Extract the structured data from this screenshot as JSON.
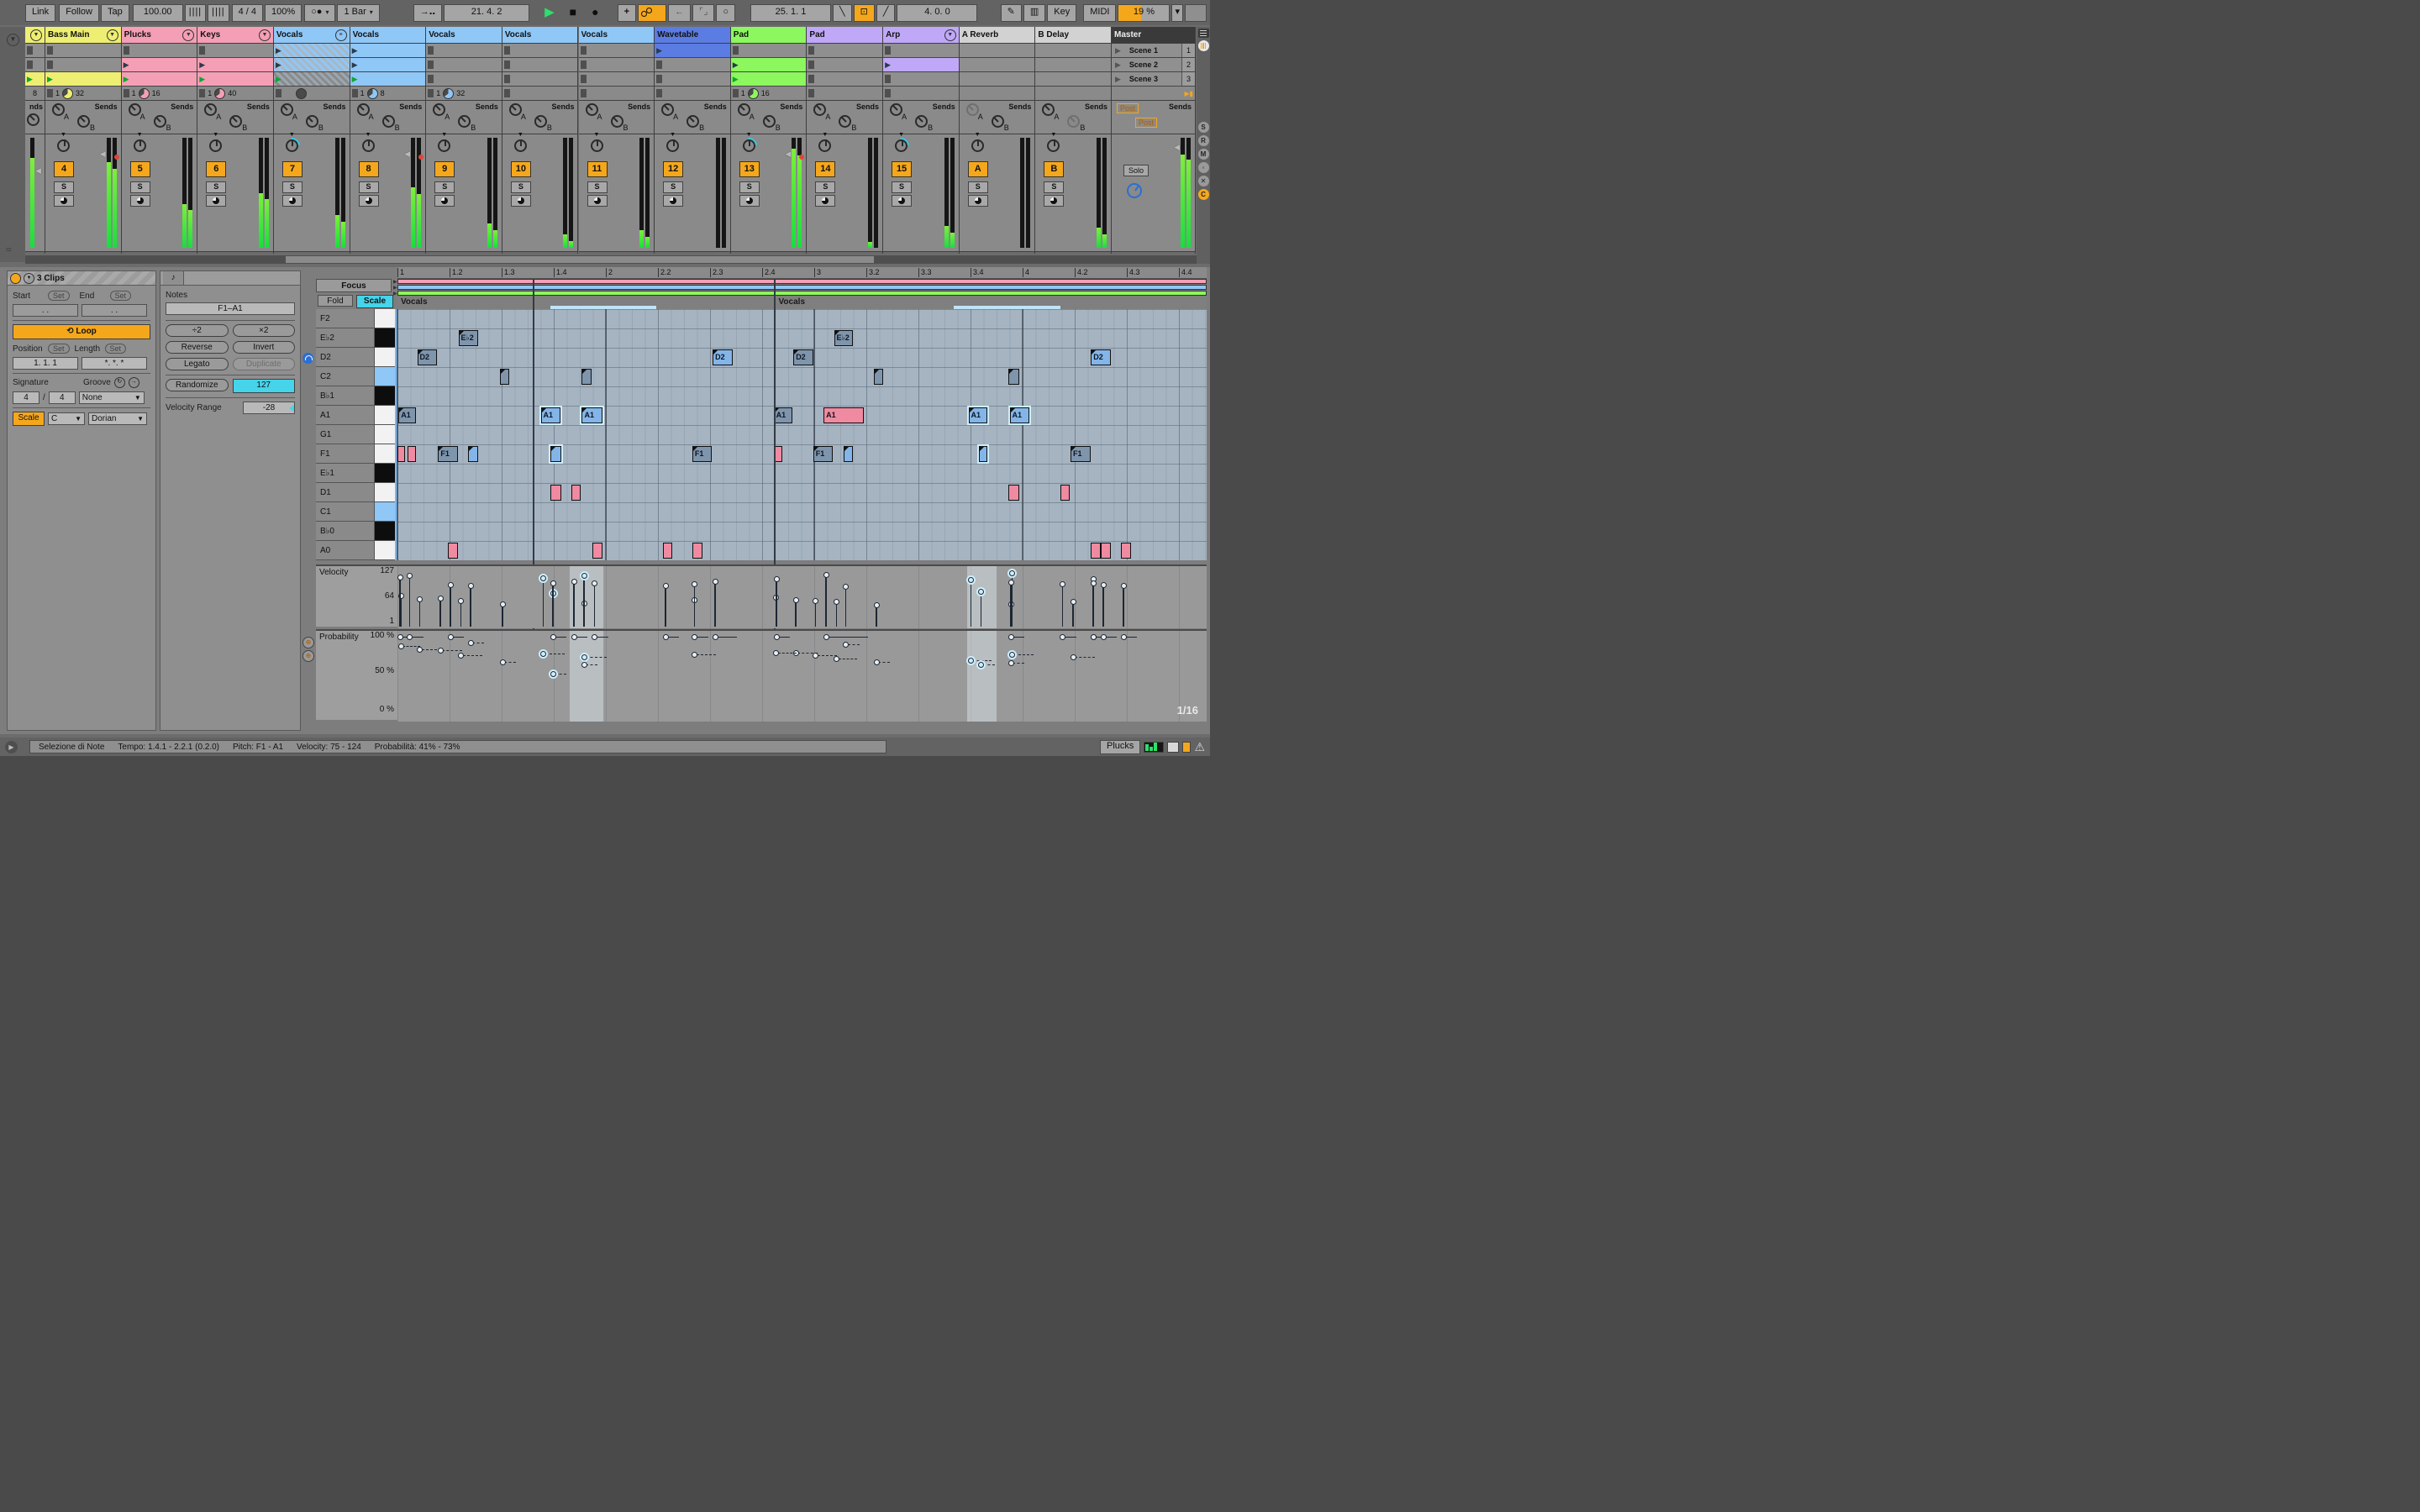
{
  "toolbar": {
    "link": "Link",
    "follow": "Follow",
    "tap": "Tap",
    "tempo": "100.00",
    "met_a": "||||",
    "met_b": "||||",
    "signature": "4 / 4",
    "global_quant": "100%",
    "metronome": "○●",
    "quantize_menu": "1 Bar",
    "follow_arrow": "→‥",
    "arrange_position": "21.  4.  2",
    "play": "▶",
    "stop": "■",
    "record": "●",
    "new": "+",
    "automation_arm": "oo",
    "reenable_automation": "←",
    "punch": "⌜⌟",
    "loop": "○",
    "loop_start": "25.  1.  1",
    "fade_in": "╲",
    "overdub": "⊡",
    "fade_out": "╱",
    "loop_length": "4.  0.  0",
    "draw": "✎",
    "fold_keys": "▥",
    "key": "Key",
    "midi": "MIDI",
    "cpu": "19 %",
    "caret": "▾"
  },
  "session": {
    "scenes": [
      {
        "name": "Scene 1",
        "num": "1"
      },
      {
        "name": "Scene 2",
        "num": "2"
      },
      {
        "name": "Scene 3",
        "num": "3"
      }
    ],
    "master_label": "Master",
    "rail_right_icons": [
      "S",
      "R",
      "M",
      "◦",
      "✕",
      "C"
    ],
    "tracks": [
      {
        "name": "",
        "color": "#eeee72",
        "narrow": true,
        "icon": "▼",
        "num": "",
        "slots": [
          "stop",
          "stop",
          "playing"
        ],
        "status": {
          "text": "8"
        },
        "meter": 0.82,
        "dot": false,
        "marker": true
      },
      {
        "name": "Bass Main",
        "color": "#eeee72",
        "icon": "▼",
        "num": "4",
        "slots": [
          "stop",
          "stop",
          "playing"
        ],
        "status": {
          "count": "1",
          "pie": "#eeee72",
          "total": "32"
        },
        "meter": 0.78,
        "dot": true,
        "marker": true
      },
      {
        "name": "Plucks",
        "color": "#f49fb6",
        "icon": "▼",
        "num": "5",
        "slots": [
          "stop",
          "clip",
          "playing"
        ],
        "status": {
          "count": "1",
          "pie": "#f49fb6",
          "total": "16"
        },
        "meter": 0.4,
        "dot": false,
        "marker": false
      },
      {
        "name": "Keys",
        "color": "#f49fb6",
        "icon": "▼",
        "num": "6",
        "slots": [
          "stop",
          "clip",
          "playing"
        ],
        "status": {
          "count": "1",
          "pie": "#f49fb6",
          "total": "40"
        },
        "meter": 0.5,
        "dot": false,
        "marker": false
      },
      {
        "name": "Vocals",
        "color": "#8fc7f7",
        "icon": "≡",
        "num": "7",
        "group": true,
        "slots": [
          "group",
          "group",
          "group-playing"
        ],
        "status": {
          "pie": "#555"
        },
        "meter": 0.3,
        "dot": false,
        "marker": false,
        "panarc": true
      },
      {
        "name": "Vocals",
        "color": "#8fc7f7",
        "icon": "",
        "num": "8",
        "slots": [
          "clip",
          "clip",
          "playing"
        ],
        "status": {
          "count": "1",
          "pie": "#8fc7f7",
          "total": "8"
        },
        "meter": 0.55,
        "dot": true,
        "marker": true
      },
      {
        "name": "Vocals",
        "color": "#8fc7f7",
        "icon": "",
        "num": "9",
        "slots": [
          "stop",
          "stop",
          "stop"
        ],
        "status": {
          "count": "1",
          "pie": "#8fc7f7",
          "total": "32"
        },
        "meter": 0.22,
        "dot": false,
        "marker": false
      },
      {
        "name": "Vocals",
        "color": "#8fc7f7",
        "icon": "",
        "num": "10",
        "slots": [
          "stop",
          "stop",
          "stop"
        ],
        "status": {
          "stop": true
        },
        "meter": 0.12,
        "dot": false,
        "marker": false
      },
      {
        "name": "Vocals",
        "color": "#8fc7f7",
        "icon": "",
        "num": "11",
        "slots": [
          "stop",
          "stop",
          "stop"
        ],
        "status": {
          "stop": true
        },
        "meter": 0.16,
        "dot": false,
        "marker": false
      },
      {
        "name": "Wavetable",
        "color": "#5b7ce2",
        "icon": "",
        "num": "12",
        "slots": [
          "clip",
          "stop",
          "stop"
        ],
        "status": {
          "stop": true
        },
        "meter": 0.0,
        "dot": false,
        "marker": false
      },
      {
        "name": "Pad",
        "color": "#8cf75e",
        "icon": "",
        "num": "13",
        "slots": [
          "stop",
          "clip",
          "playing"
        ],
        "status": {
          "count": "1",
          "pie": "#8cf75e",
          "total": "16"
        },
        "meter": 0.9,
        "dot": true,
        "marker": true,
        "panarc": true
      },
      {
        "name": "Pad",
        "color": "#c0a8f8",
        "icon": "",
        "num": "14",
        "slots": [
          "stop",
          "stop",
          "stop"
        ],
        "status": {
          "stop": true
        },
        "meter": 0.05,
        "dot": false,
        "marker": false
      },
      {
        "name": "Arp",
        "color": "#c0a8f8",
        "icon": "▼",
        "num": "15",
        "slots": [
          "stop",
          "clip",
          "stop"
        ],
        "status": {
          "stop": true
        },
        "meter": 0.2,
        "dot": false,
        "marker": false,
        "panarc": true
      },
      {
        "name": "A Reverb",
        "color": "#d2d2d2",
        "icon": "",
        "num": "A",
        "return": true,
        "slots": [
          "empty",
          "empty",
          "empty"
        ],
        "status": {},
        "meter": 0.0,
        "dot": false,
        "marker": false,
        "grayA": true
      },
      {
        "name": "B Delay",
        "color": "#d2d2d2",
        "icon": "",
        "num": "B",
        "return": true,
        "slots": [
          "empty",
          "empty",
          "empty"
        ],
        "status": {},
        "meter": 0.18,
        "dot": false,
        "marker": false,
        "grayB": true
      }
    ],
    "sends_label": "Sends",
    "master": {
      "post_a": "Post",
      "post_b": "Post",
      "solo": "Solo",
      "meter": 0.85
    }
  },
  "clip_panel": {
    "title": "3 Clips",
    "start": "Start",
    "end": "End",
    "set": "Set",
    "start_val": ".      .",
    "end_val": ".      .",
    "loop": "Loop",
    "position": "Position",
    "length": "Length",
    "position_val": "1.   1.   1",
    "length_val": "*.   *.   *",
    "signature": "Signature",
    "sig_n": "4",
    "sig_d": "4",
    "groove": "Groove",
    "groove_val": "None",
    "scale": "Scale",
    "root": "C",
    "scale_name": "Dorian"
  },
  "notes_panel": {
    "tab_icon": "♪",
    "notes_label": "Notes",
    "range": "F1–A1",
    "div2": "÷2",
    "mul2": "×2",
    "reverse": "Reverse",
    "invert": "Invert",
    "legato": "Legato",
    "duplicate": "Duplicate",
    "randomize": "Randomize",
    "randomize_val": "127",
    "velocity_range": "Velocity Range",
    "velocity_range_val": "-28"
  },
  "piano_roll": {
    "focus": "Focus",
    "fold": "Fold",
    "scale": "Scale",
    "ruler": [
      "1",
      "1.2",
      "1.3",
      "1.4",
      "2",
      "2.2",
      "2.3",
      "2.4",
      "3",
      "3.2",
      "3.3",
      "3.4",
      "4",
      "4.2",
      "4.3",
      "4.4"
    ],
    "region_labels": [
      "Vocals",
      "Vocals"
    ],
    "region_starts": [
      0,
      7.25
    ],
    "clip_lane_colors": [
      "#f49fb6",
      "#8fc7f7",
      "#8cf75e"
    ],
    "loop_braces": [
      [
        2.94,
        4.97
      ],
      [
        10.67,
        12.73
      ]
    ],
    "boundaries": [
      2.6,
      7.23
    ],
    "keys": [
      {
        "name": "F2",
        "type": "white"
      },
      {
        "name": "E♭2",
        "type": "black"
      },
      {
        "name": "D2",
        "type": "white"
      },
      {
        "name": "C2",
        "type": "root"
      },
      {
        "name": "B♭1",
        "type": "black"
      },
      {
        "name": "A1",
        "type": "white"
      },
      {
        "name": "G1",
        "type": "white"
      },
      {
        "name": "F1",
        "type": "white"
      },
      {
        "name": "E♭1",
        "type": "black"
      },
      {
        "name": "D1",
        "type": "white"
      },
      {
        "name": "C1",
        "type": "root"
      },
      {
        "name": "B♭0",
        "type": "black"
      },
      {
        "name": "A0",
        "type": "white"
      }
    ],
    "grid_division": "1/16",
    "notes": [
      {
        "row": 1,
        "start": 1.17,
        "len": 0.38,
        "label": "E♭2",
        "style": "gray",
        "v": 58,
        "p": 70
      },
      {
        "row": 1,
        "start": 8.38,
        "len": 0.37,
        "label": "E♭2",
        "style": "gray",
        "v": 55,
        "p": 65
      },
      {
        "row": 2,
        "start": 0.38,
        "len": 0.38,
        "label": "D2",
        "style": "gray",
        "v": 62,
        "p": 80
      },
      {
        "row": 2,
        "start": 6.05,
        "len": 0.38,
        "label": "D2",
        "style": "bright",
        "v": 105,
        "p": 100
      },
      {
        "row": 2,
        "start": 7.6,
        "len": 0.38,
        "label": "D2",
        "style": "gray",
        "v": 60,
        "p": 75
      },
      {
        "row": 2,
        "start": 13.31,
        "len": 0.39,
        "label": "D2",
        "style": "bright",
        "v": 110,
        "p": 100
      },
      {
        "row": 3,
        "start": 1.97,
        "len": 0.17,
        "label": "",
        "style": "gray",
        "v": 50,
        "p": 60
      },
      {
        "row": 3,
        "start": 3.54,
        "len": 0.18,
        "label": "",
        "style": "gray",
        "v": 52,
        "p": 55
      },
      {
        "row": 3,
        "start": 9.15,
        "len": 0.18,
        "label": "",
        "style": "gray",
        "v": 48,
        "p": 60
      },
      {
        "row": 3,
        "start": 11.73,
        "len": 0.2,
        "label": "",
        "style": "gray",
        "v": 50,
        "p": 58
      },
      {
        "row": 5,
        "start": 0.02,
        "len": 0.34,
        "label": "A1",
        "style": "gray",
        "v": 70,
        "p": 85
      },
      {
        "row": 5,
        "start": 2.75,
        "len": 0.38,
        "label": "A1",
        "style": "bright",
        "sel": true,
        "v": 112,
        "p": 73
      },
      {
        "row": 5,
        "start": 3.54,
        "len": 0.39,
        "label": "A1",
        "style": "bright",
        "sel": true,
        "v": 118,
        "p": 68
      },
      {
        "row": 5,
        "start": 7.22,
        "len": 0.36,
        "label": "A1",
        "style": "gray",
        "v": 66,
        "p": 75
      },
      {
        "row": 5,
        "start": 8.18,
        "len": 0.77,
        "label": "A1",
        "style": "pink",
        "v": 120,
        "p": 100
      },
      {
        "row": 5,
        "start": 10.96,
        "len": 0.37,
        "label": "A1",
        "style": "bright",
        "sel": true,
        "v": 108,
        "p": 62
      },
      {
        "row": 5,
        "start": 11.75,
        "len": 0.38,
        "label": "A1",
        "style": "bright",
        "sel": true,
        "v": 124,
        "p": 71
      },
      {
        "row": 7,
        "start": 0.0,
        "len": 0.15,
        "label": "",
        "style": "pink",
        "v": 115,
        "p": 100
      },
      {
        "row": 7,
        "start": 0.19,
        "len": 0.16,
        "label": "",
        "style": "pink",
        "v": 118,
        "p": 100
      },
      {
        "row": 7,
        "start": 0.78,
        "len": 0.38,
        "label": "F1",
        "style": "gray",
        "v": 64,
        "p": 78
      },
      {
        "row": 7,
        "start": 1.36,
        "len": 0.19,
        "label": "",
        "style": "bright",
        "v": 95,
        "p": 90
      },
      {
        "row": 7,
        "start": 2.94,
        "len": 0.2,
        "label": "",
        "style": "bright",
        "sel": true,
        "v": 75,
        "p": 41
      },
      {
        "row": 7,
        "start": 5.66,
        "len": 0.38,
        "label": "F1",
        "style": "gray",
        "v": 60,
        "p": 72
      },
      {
        "row": 7,
        "start": 7.23,
        "len": 0.15,
        "label": "",
        "style": "pink",
        "v": 110,
        "p": 100
      },
      {
        "row": 7,
        "start": 7.98,
        "len": 0.38,
        "label": "F1",
        "style": "gray",
        "v": 58,
        "p": 70
      },
      {
        "row": 7,
        "start": 8.56,
        "len": 0.19,
        "label": "",
        "style": "bright",
        "v": 92,
        "p": 88
      },
      {
        "row": 7,
        "start": 11.16,
        "len": 0.17,
        "label": "",
        "style": "bright",
        "sel": true,
        "v": 80,
        "p": 55
      },
      {
        "row": 7,
        "start": 12.92,
        "len": 0.39,
        "label": "F1",
        "style": "gray",
        "v": 56,
        "p": 68
      },
      {
        "row": 9,
        "start": 2.94,
        "len": 0.2,
        "label": "",
        "style": "pink",
        "v": 100,
        "p": 100
      },
      {
        "row": 9,
        "start": 3.34,
        "len": 0.18,
        "label": "",
        "style": "pink",
        "v": 105,
        "p": 100
      },
      {
        "row": 9,
        "start": 11.73,
        "len": 0.2,
        "label": "",
        "style": "pink",
        "v": 102,
        "p": 100
      },
      {
        "row": 9,
        "start": 12.72,
        "len": 0.18,
        "label": "",
        "style": "pink",
        "v": 98,
        "p": 100
      },
      {
        "row": 12,
        "start": 0.97,
        "len": 0.19,
        "label": "",
        "style": "pink",
        "v": 96,
        "p": 100
      },
      {
        "row": 12,
        "start": 3.74,
        "len": 0.19,
        "label": "",
        "style": "pink",
        "v": 100,
        "p": 100
      },
      {
        "row": 12,
        "start": 5.1,
        "len": 0.17,
        "label": "",
        "style": "pink",
        "v": 94,
        "p": 100
      },
      {
        "row": 12,
        "start": 5.66,
        "len": 0.19,
        "label": "",
        "style": "pink",
        "v": 98,
        "p": 100
      },
      {
        "row": 12,
        "start": 13.31,
        "len": 0.19,
        "label": "",
        "style": "pink",
        "v": 100,
        "p": 100
      },
      {
        "row": 12,
        "start": 13.5,
        "len": 0.19,
        "label": "",
        "style": "pink",
        "v": 97,
        "p": 100
      },
      {
        "row": 12,
        "start": 13.89,
        "len": 0.19,
        "label": "",
        "style": "pink",
        "v": 95,
        "p": 100
      }
    ],
    "sel_columns": [
      [
        3.3,
        3.95
      ],
      [
        10.94,
        11.5
      ]
    ]
  },
  "velocity_lane": {
    "label": "Velocity",
    "ticks": [
      "127",
      "64",
      "1"
    ]
  },
  "probability_lane": {
    "label": "Probability",
    "ticks": [
      "100 %",
      "50 %",
      "0 %"
    ]
  },
  "status_bar": {
    "selection": "Selezione di Note",
    "tempo": "Tempo: 1.4.1 - 2.2.1 (0.2.0)",
    "pitch": "Pitch: F1 - A1",
    "velocity": "Velocity: 75 - 124",
    "probability": "Probabilità: 41% - 73%",
    "track_button": "Plucks",
    "warning_icon": "⚠"
  }
}
